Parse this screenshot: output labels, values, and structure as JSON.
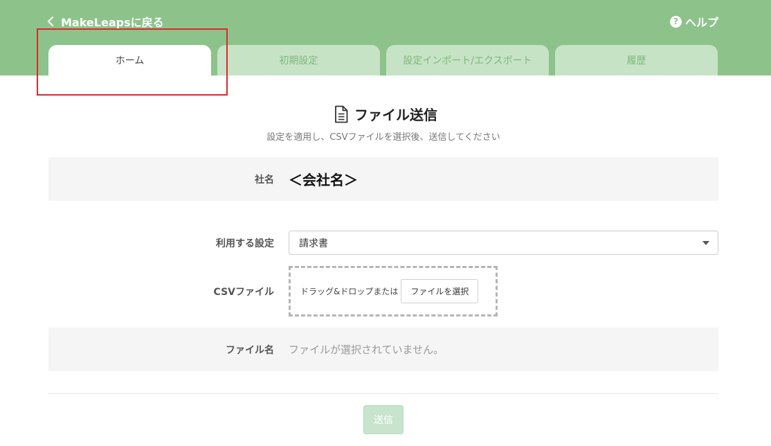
{
  "header": {
    "back_label": "MakeLeapsに戻る",
    "help_label": "ヘルプ",
    "help_icon_glyph": "?",
    "bg_color": "#8dc38b"
  },
  "tabs": [
    {
      "label": "ホーム",
      "active": true
    },
    {
      "label": "初期設定",
      "active": false
    },
    {
      "label": "設定インポート/エクスポート",
      "active": false
    },
    {
      "label": "履歴",
      "active": false
    }
  ],
  "main": {
    "title": "ファイル送信",
    "title_icon": "document-icon",
    "subtitle": "設定を適用し、CSVファイルを選択後、送信してください"
  },
  "form": {
    "company_label": "社名",
    "company_value": "＜会社名＞",
    "setting_label": "利用する設定",
    "setting_value": "請求書",
    "csv_label": "CSVファイル",
    "drop_text": "ドラッグ&ドロップまたは",
    "choose_file_label": "ファイルを選択",
    "filename_label": "ファイル名",
    "filename_value": "ファイルが選択されていません。"
  },
  "actions": {
    "submit_label": "送信"
  },
  "colors": {
    "accent": "#8dc38b",
    "tab_inactive": "#c7e3c6",
    "highlight": "#e0262b"
  }
}
